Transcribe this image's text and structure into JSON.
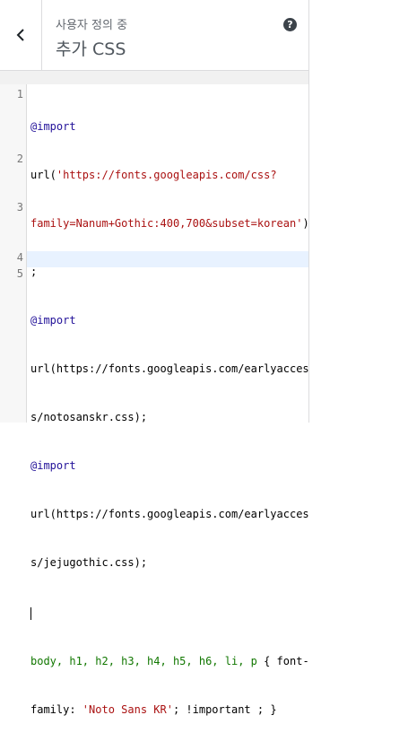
{
  "header": {
    "subtitle": "사용자 정의 중",
    "title": "추가 CSS",
    "help_label": "?"
  },
  "editor": {
    "line_numbers": [
      "1",
      "2",
      "3",
      "4",
      "5"
    ],
    "lines": {
      "l1_import": "@import",
      "l1_url_open": "url(",
      "l1_str_a": "'https://fonts.googleapis.com/css?",
      "l1_str_b": "family=Nanum+Gothic:400,700&subset=korean'",
      "l1_close": ")",
      "l1_semi": ";",
      "l2_import": "@import",
      "l2_url_a": "url(https://fonts.googleapis.com/earlyacces",
      "l2_url_b": "s/notosanskr.css);",
      "l3_import": "@import",
      "l3_url_a": "url(https://fonts.googleapis.com/earlyacces",
      "l3_url_b": "s/jejugothic.css);",
      "l5_selectors": "body, h1, h2, h3, h4, h5, h6, li, p",
      "l5_brace": " { font-",
      "l5_prop": "family: ",
      "l5_value": "'Noto Sans KR'",
      "l5_rest": "; !important ; }"
    }
  },
  "colors": {
    "panel_bg": "#f1f1f1",
    "keyword": "#221199",
    "string": "#aa1111",
    "selector": "#117700",
    "active_line": "#e8f2ff"
  },
  "icons": {
    "back": "chevron-left-icon",
    "help": "help-icon"
  }
}
